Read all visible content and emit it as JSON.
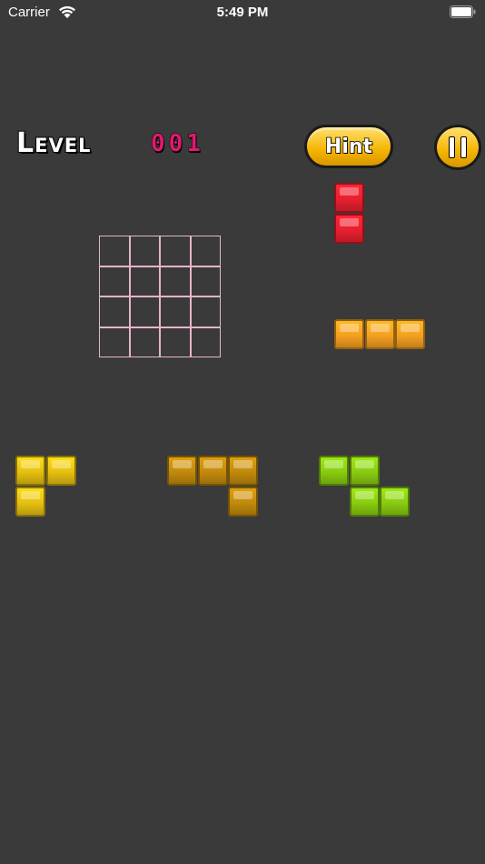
{
  "status_bar": {
    "carrier": "Carrier",
    "time": "5:49 PM"
  },
  "header": {
    "level_label": "Level",
    "level_number": "001",
    "hint_label": "Hint"
  },
  "board": {
    "rows": 4,
    "cols": 4,
    "grid_color": "#e6b3cc"
  },
  "pieces": [
    {
      "name": "red-piece",
      "color": "#e8202f",
      "cells": [
        [
          0,
          0
        ],
        [
          0,
          1
        ]
      ]
    },
    {
      "name": "orange-piece",
      "color": "#f5a020",
      "cells": [
        [
          0,
          0
        ],
        [
          1,
          0
        ],
        [
          2,
          0
        ]
      ]
    },
    {
      "name": "yellow-piece",
      "color": "#e6c010",
      "cells": [
        [
          0,
          0
        ],
        [
          1,
          0
        ],
        [
          0,
          1
        ]
      ]
    },
    {
      "name": "brown-piece",
      "color": "#c28a0c",
      "cells": [
        [
          0,
          0
        ],
        [
          1,
          0
        ],
        [
          2,
          0
        ],
        [
          2,
          1
        ]
      ]
    },
    {
      "name": "green-piece",
      "color": "#88cc10",
      "cells": [
        [
          0,
          0
        ],
        [
          1,
          0
        ],
        [
          1,
          1
        ],
        [
          2,
          1
        ]
      ]
    }
  ]
}
